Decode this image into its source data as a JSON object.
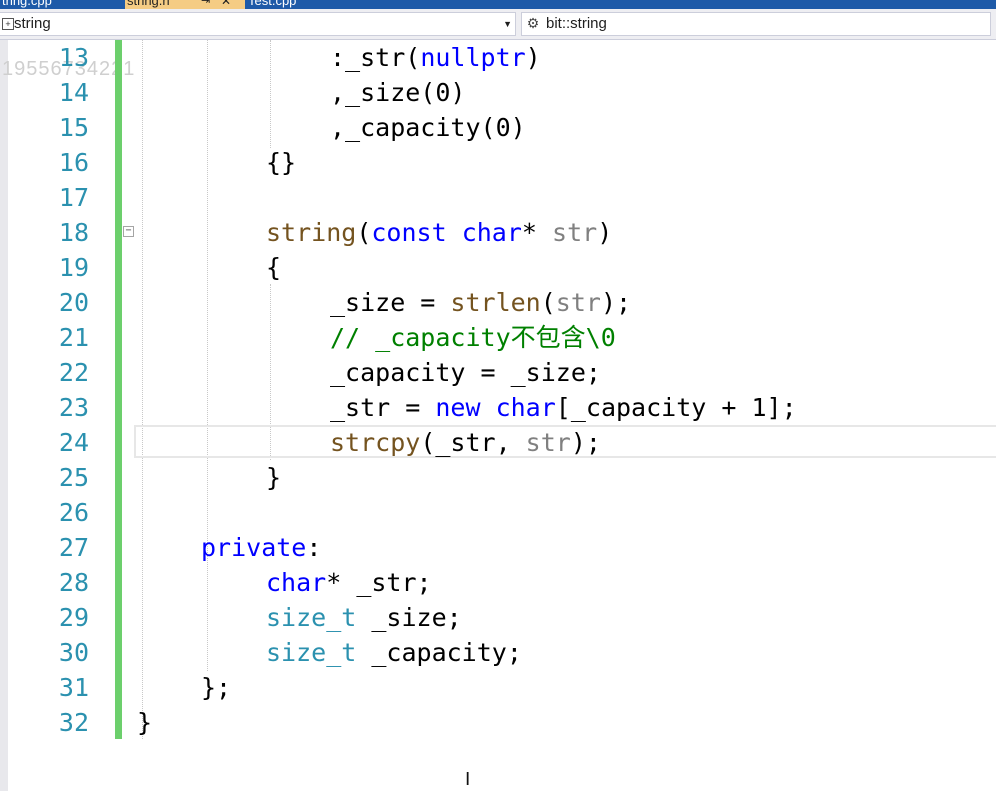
{
  "tabs": [
    {
      "label": "tring.cpp",
      "active": false
    },
    {
      "label": "string.h",
      "active": true
    },
    {
      "label": "Test.cpp",
      "active": false
    }
  ],
  "navbar": {
    "scope_label": "string",
    "member_label": "bit::string"
  },
  "watermark": "19556734221",
  "line_numbers": [
    "13",
    "14",
    "15",
    "16",
    "17",
    "18",
    "19",
    "20",
    "21",
    "22",
    "23",
    "24",
    "25",
    "26",
    "27",
    "28",
    "29",
    "30",
    "31",
    "32"
  ],
  "code": {
    "l13_a": ":_str(",
    "l13_b": "nullptr",
    "l13_c": ")",
    "l14": ",_size(0)",
    "l15": ",_capacity(0)",
    "l16": "{}",
    "l18_a": "string",
    "l18_b": "(",
    "l18_c": "const",
    "l18_d": " ",
    "l18_e": "char",
    "l18_f": "* ",
    "l18_g": "str",
    "l18_h": ")",
    "l19": "{",
    "l20_a": "_size = ",
    "l20_b": "strlen",
    "l20_c": "(",
    "l20_d": "str",
    "l20_e": ");",
    "l21_a": "// _capacity",
    "l21_b": "不包含",
    "l21_c": "\\0",
    "l22": "_capacity = _size;",
    "l23_a": "_str = ",
    "l23_b": "new",
    "l23_c": " ",
    "l23_d": "char",
    "l23_e": "[_capacity + 1];",
    "l24_a": "strcpy",
    "l24_b": "(_str, ",
    "l24_c": "str",
    "l24_d": ");",
    "l25": "}",
    "l27_a": "private",
    "l27_b": ":",
    "l28_a": "char",
    "l28_b": "* _str;",
    "l29_a": "size_t",
    "l29_b": " _size;",
    "l30_a": "size_t",
    "l30_b": " _capacity;",
    "l31": "};",
    "l32": "}"
  },
  "colors": {
    "keyword": "#0000ff",
    "type": "#2b91af",
    "function": "#74531f",
    "parameter": "#808080",
    "comment": "#008000",
    "line_number": "#2b91af",
    "change_bar": "#6ccf6c"
  }
}
